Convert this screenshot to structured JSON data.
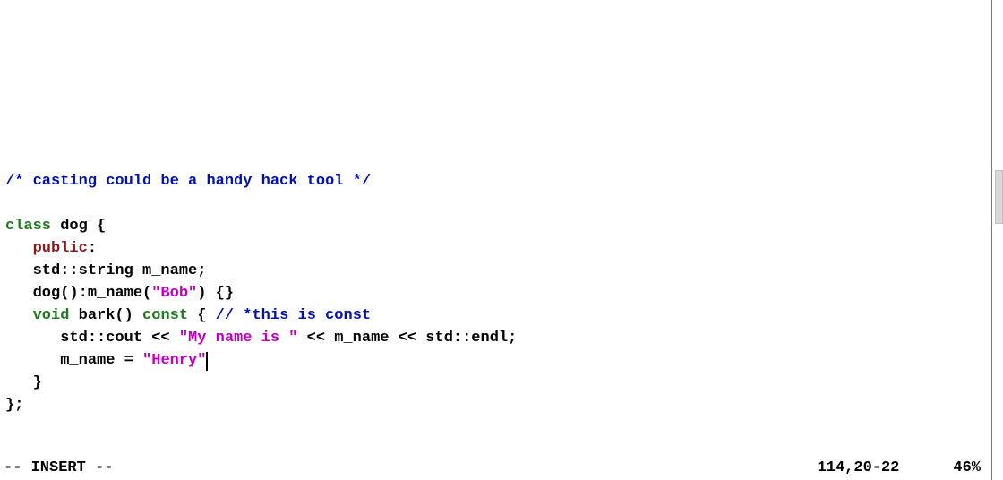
{
  "code": {
    "comment_open": "/* ",
    "comment_body": "casting could be a handy hack tool",
    "comment_close": " */",
    "kw_class": "class",
    "cls_name": " dog {",
    "kw_public": "public",
    "colon": ":",
    "line_member": "std::string m_name;",
    "ctor_pre": "dog():m_name(",
    "ctor_str": "\"Bob\"",
    "ctor_post": ") {}",
    "kw_void": "void",
    "bark_sig": " bark() ",
    "kw_const": "const",
    "bark_open": " { ",
    "bark_comment": "// *this is const",
    "cout_pre": "std::cout << ",
    "cout_str": "\"My name is \"",
    "cout_post": " << m_name << std::endl;",
    "assign_pre": "m_name = ",
    "assign_str": "\"Henry\"",
    "close_inner": "}",
    "close_class": "};",
    "indent1": "   ",
    "indent2": "      "
  },
  "status": {
    "mode": "-- INSERT --",
    "pos": "114,20-22",
    "pct": "46%"
  }
}
